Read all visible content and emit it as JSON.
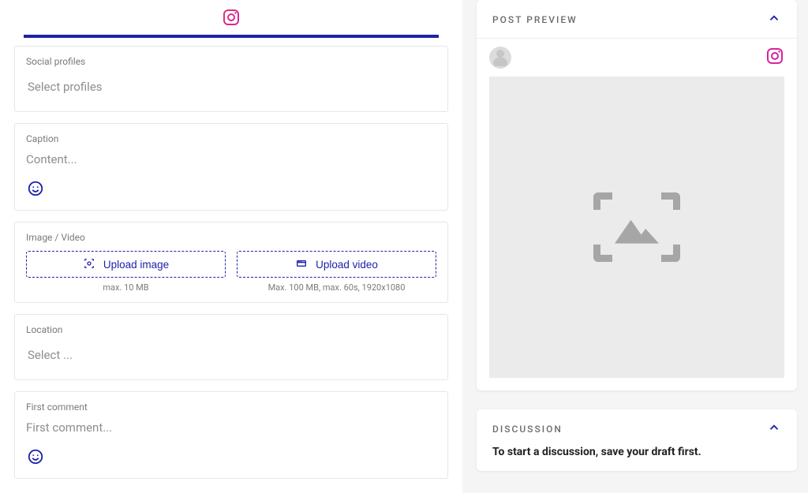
{
  "composer": {
    "social_profiles": {
      "label": "Social profiles",
      "placeholder": "Select profiles"
    },
    "caption": {
      "label": "Caption",
      "placeholder": "Content..."
    },
    "media": {
      "label": "Image / Video",
      "upload_image": {
        "label": "Upload image",
        "hint": "max. 10 MB"
      },
      "upload_video": {
        "label": "Upload video",
        "hint": "Max. 100 MB, max. 60s, 1920x1080"
      }
    },
    "location": {
      "label": "Location",
      "placeholder": "Select ..."
    },
    "first_comment": {
      "label": "First comment",
      "placeholder": "First comment..."
    }
  },
  "preview": {
    "title": "POST PREVIEW"
  },
  "discussion": {
    "title": "DISCUSSION",
    "empty": "To start a discussion, save your draft first."
  },
  "colors": {
    "brand": "#1e22aa",
    "instagram": "#d6249f"
  }
}
